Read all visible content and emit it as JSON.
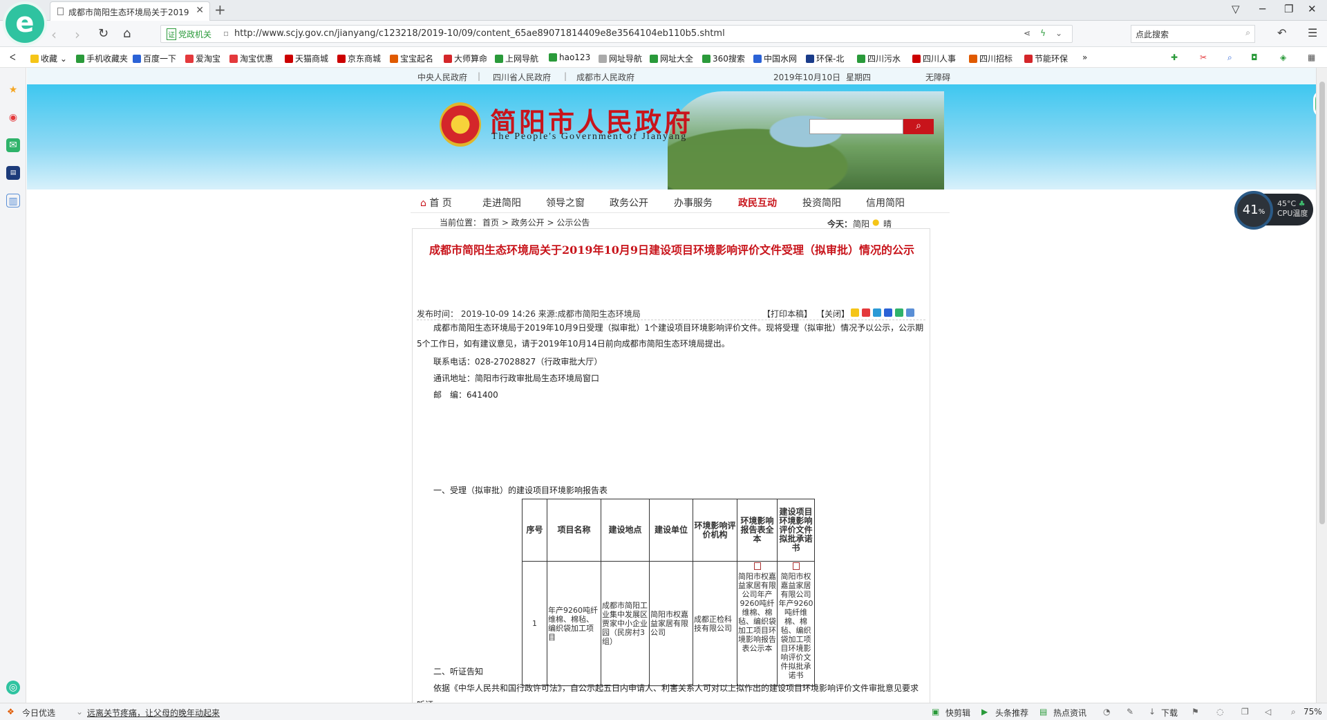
{
  "browser": {
    "tab_title": "成都市简阳生态环境局关于2019",
    "new_tab": "+",
    "url": "http://www.scjy.gov.cn/jianyang/c123218/2019-10/09/content_65ae89071814409e8e3564104eb110b5.shtml",
    "site_badge": "党政机关",
    "site_badge_mark": "证",
    "search_placeholder": "点此搜索",
    "logo_letter": "e"
  },
  "favorites": [
    "收藏",
    "手机收藏夹",
    "百度一下",
    "爱淘宝",
    "淘宝优惠",
    "天猫商城",
    "京东商城",
    "宝宝起名",
    "大师算命",
    "上网导航",
    "hao123",
    "网址导航",
    "网址大全",
    "360搜索",
    "中国水网",
    "环保-北",
    "四川污水",
    "四川人事",
    "四川招标",
    "节能环保",
    "»"
  ],
  "site": {
    "top_links": [
      "中央人民政府",
      "|",
      "四川省人民政府",
      "|",
      "成都市人民政府"
    ],
    "date": "2019年10月10日",
    "weekday": "星期四",
    "accessibility": "无障碍",
    "title": "简阳市人民政府",
    "subtitle": "The People's Government of Jianyang",
    "nav": [
      "首 页",
      "走进简阳",
      "领导之窗",
      "政务公开",
      "办事服务",
      "政民互动",
      "投资简阳",
      "信用简阳"
    ],
    "nav_active": "政民互动",
    "breadcrumb_label": "当前位置：",
    "breadcrumb": "首页 > 政务公开 > 公示公告",
    "today_label": "今天：",
    "today_city": "简阳",
    "today_weather": "晴"
  },
  "article": {
    "title": "成都市简阳生态环境局关于2019年10月9日建设项目环境影响评价文件受理（拟审批）情况的公示",
    "meta": "发布时间：  2019-10-09 14:26 来源:成都市简阳生态环境局",
    "print": "【打印本稿】",
    "close": "【关闭】",
    "intro": "成都市简阳生态环境局于2019年10月9日受理（拟审批）1个建设项目环境影响评价文件。现将受理（拟审批）情况予以公示，公示期5个工作日，如有建议意见，请于2019年10月14日前向成都市简阳生态环境局提出。",
    "phone": "联系电话：028-27028827（行政审批大厅）",
    "address": "通讯地址：简阳市行政审批局生态环境局窗口",
    "postcode": "邮　编：641400",
    "section1": "一、受理（拟审批）的建设项目环境影响报告表",
    "table": {
      "headers": [
        "序号",
        "项目名称",
        "建设地点",
        "建设单位",
        "环境影响评价机构",
        "环境影响报告表全本",
        "建设项目环境影响评价文件拟批承诺书"
      ],
      "rows": [
        [
          "1",
          "年产9260吨纤维棉、棉毡、编织袋加工项目",
          "成都市简阳工业集中发展区贾家中小企业园（民房村3组）",
          "简阳市权嘉益家居有限公司",
          "成都正检科技有限公司",
          "简阳市权嘉益家居有限公司年产9260吨纤维棉、棉毡、编织袋加工项目环境影响报告表公示本",
          "简阳市权嘉益家居有限公司年产9260吨纤维棉、棉毡、编织袋加工项目环境影响评价文件拟批承诺书"
        ]
      ]
    },
    "section2": "二、听证告知",
    "hearing": "依据《中华人民共和国行政许可法》，自公示起五日内申请人、利害关系人可对以上拟作出的建设项目环境影响评价文件审批意见要求听证。"
  },
  "widget": {
    "cpu_percent": "41",
    "cpu_percent_unit": "%",
    "cpu_temp": "45°C",
    "cpu_label": "CPU温度",
    "side_badge": "41"
  },
  "statusbar": {
    "today_pick": "今日优选",
    "news": "远离关节疼痛，让父母的晚年动起来",
    "items": [
      "快剪辑",
      "头条推荐",
      "热点资讯",
      "下载"
    ],
    "zoom": "75%"
  }
}
